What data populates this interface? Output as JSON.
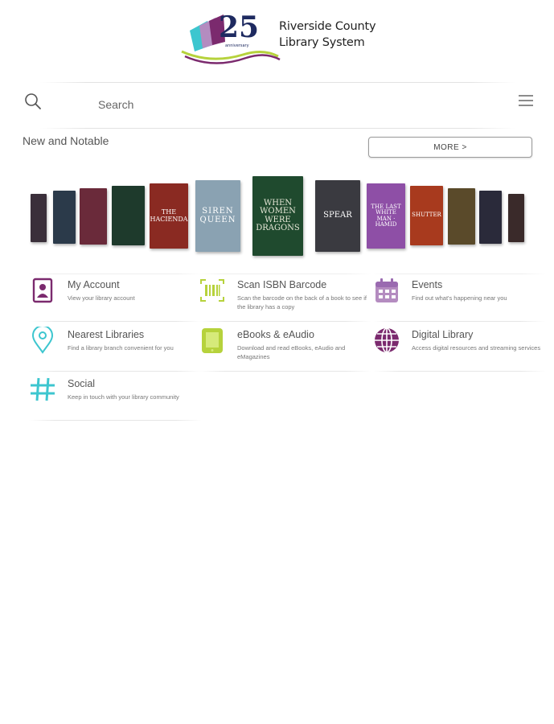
{
  "header": {
    "logo_line1": "Riverside County",
    "logo_line2": "Library System",
    "logo_badge_number": "25",
    "logo_badge_word": "anniversary"
  },
  "search": {
    "placeholder": "Search"
  },
  "new_and_notable": {
    "title": "New and Notable",
    "more_label": "MORE >",
    "books": [
      {
        "cover_text": "",
        "color": "#3a2f3a"
      },
      {
        "cover_text": "",
        "color": "#2b3a4a"
      },
      {
        "cover_text": "",
        "color": "#6a2a3a"
      },
      {
        "cover_text": "",
        "color": "#1e3a2c"
      },
      {
        "cover_text": "THE HACIENDA",
        "color": "#8a2a22"
      },
      {
        "cover_text": "SIREN QUEEN",
        "color": "#8aa2b2"
      },
      {
        "cover_text": "WHEN WOMEN WERE DRAGONS",
        "color": "#1f4a2e"
      },
      {
        "cover_text": "SPEAR",
        "color": "#3a3a40"
      },
      {
        "cover_text": "THE LAST WHITE MAN · HAMID",
        "color": "#8e4fa6"
      },
      {
        "cover_text": "SHUTTER",
        "color": "#a83a1e"
      },
      {
        "cover_text": "",
        "color": "#5a4a2a"
      },
      {
        "cover_text": "",
        "color": "#2a2a3a"
      },
      {
        "cover_text": "",
        "color": "#3a2a2a"
      }
    ]
  },
  "tiles": [
    {
      "title": "My Account",
      "desc": "View your library account",
      "icon": "account-icon",
      "color": "#7b2a6e"
    },
    {
      "title": "Scan ISBN Barcode",
      "desc": "Scan the barcode on the back of a book to see if the library has a copy",
      "icon": "barcode-icon",
      "color": "#b6d23c"
    },
    {
      "title": "Events",
      "desc": "Find out what's happening near you",
      "icon": "calendar-icon",
      "color": "#b48cc0"
    },
    {
      "title": "Nearest Libraries",
      "desc": "Find a library branch convenient for you",
      "icon": "location-pin-icon",
      "color": "#3dc6cf"
    },
    {
      "title": "eBooks & eAudio",
      "desc": "Download and read eBooks, eAudio and eMagazines",
      "icon": "tablet-icon",
      "color": "#b6d23c"
    },
    {
      "title": "Digital Library",
      "desc": "Access digital resources and streaming services",
      "icon": "globe-icon",
      "color": "#7b2a6e"
    },
    {
      "title": "Social",
      "desc": "Keep in touch with your library community",
      "icon": "hashtag-icon",
      "color": "#3dc6cf"
    }
  ]
}
